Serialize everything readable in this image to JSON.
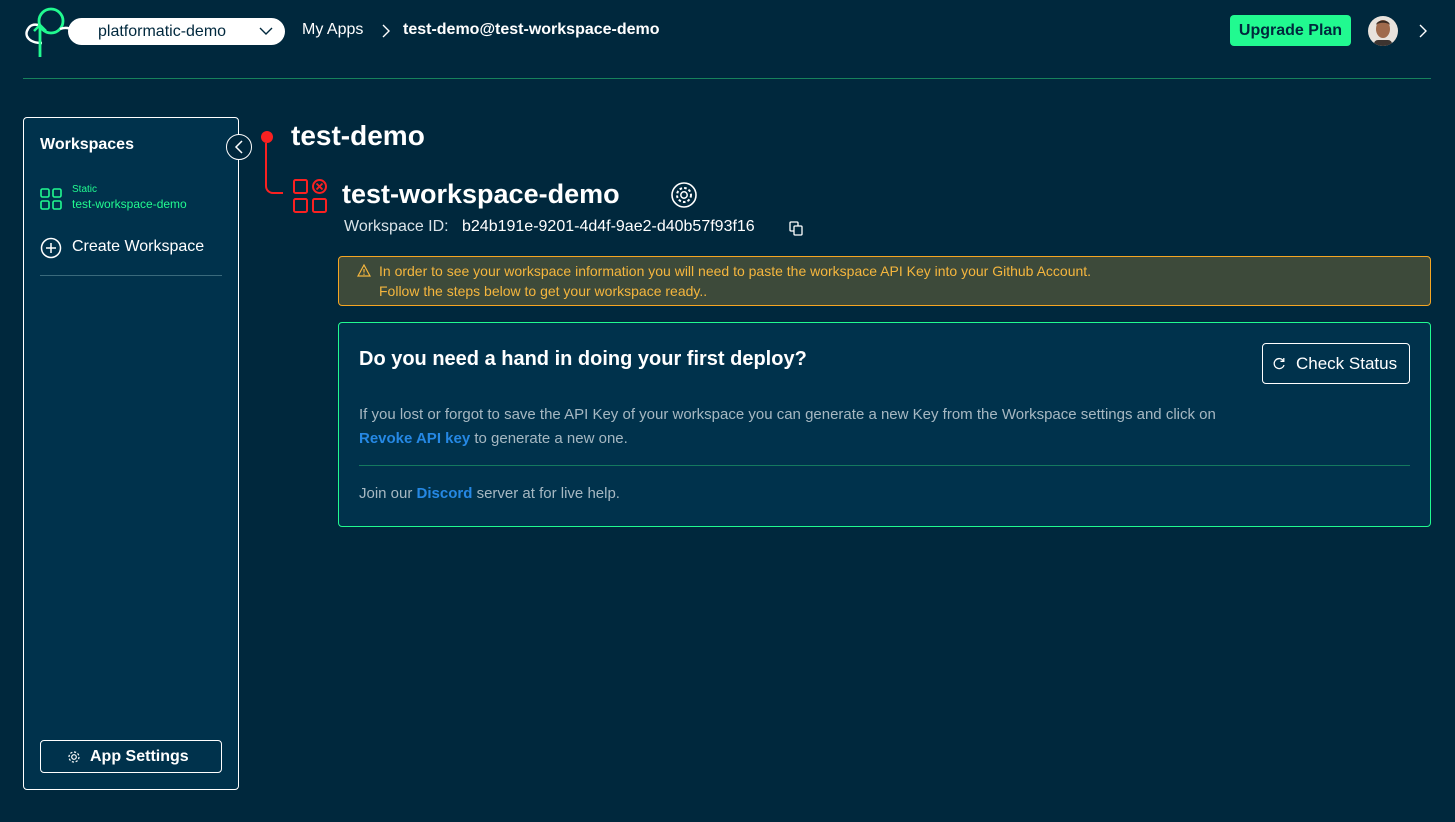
{
  "header": {
    "org_name": "platformatic-demo",
    "breadcrumb_apps": "My Apps",
    "breadcrumb_current": "test-demo@test-workspace-demo",
    "upgrade_label": "Upgrade Plan"
  },
  "sidebar": {
    "title": "Workspaces",
    "workspace": {
      "type": "Static",
      "name": "test-workspace-demo"
    },
    "create_label": "Create Workspace",
    "settings_label": "App Settings"
  },
  "main": {
    "app_name": "test-demo",
    "workspace_name": "test-workspace-demo",
    "workspace_id_label": "Workspace ID:",
    "workspace_id": "b24b191e-9201-4d4f-9ae2-d40b57f93f16",
    "warning": {
      "line1": "In order to see your workspace information you will need to paste the workspace API Key into your Github Account.",
      "line2": "Follow the steps below to get your workspace ready.."
    },
    "help": {
      "title": "Do you need a hand in doing your first deploy?",
      "check_label": "Check Status",
      "p1_before": "If you lost or forgot to save the API Key of your workspace you can generate a new Key from the Workspace settings and click on ",
      "p1_link": "Revoke API key",
      "p1_after": " to generate a new one.",
      "p2_before": "Join our ",
      "p2_link": "Discord",
      "p2_after": " server at for live help."
    }
  },
  "colors": {
    "background": "#00283d",
    "accent": "#21fa90",
    "danger": "#fa2121",
    "warning": "#f5a623",
    "link": "#2588e4"
  },
  "icons": [
    "platformatic-logo-icon",
    "chevron-down-icon",
    "chevron-right-icon",
    "avatar",
    "chevron-left-icon",
    "workspace-grid-icon",
    "plus-circle-icon",
    "gear-icon",
    "copy-icon",
    "warning-icon",
    "refresh-icon"
  ]
}
